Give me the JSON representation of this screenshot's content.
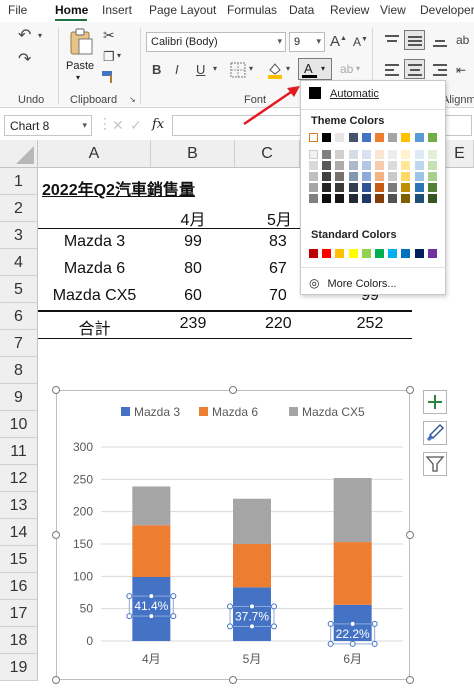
{
  "ribbon": {
    "tabs": [
      "File",
      "Home",
      "Insert",
      "Page Layout",
      "Formulas",
      "Data",
      "Review",
      "View",
      "Developer"
    ],
    "active_tab": "Home",
    "groups": {
      "undo": "Undo",
      "clipboard": "Clipboard",
      "font": "Font",
      "alignment": "Alignm"
    },
    "paste_label": "Paste",
    "font_name": "Calibri (Body)",
    "font_size": "9",
    "font_color_letter": "A",
    "bold": "B",
    "italic": "I",
    "underline": "U",
    "grow_font": "A",
    "shrink_font": "A"
  },
  "formula_bar": {
    "name_box": "Chart 8",
    "fx": "fx"
  },
  "color_menu": {
    "automatic": "Automatic",
    "theme_colors_header": "Theme Colors",
    "standard_colors_header": "Standard Colors",
    "more_colors": "More Colors...",
    "theme_colors": [
      [
        "#ffffff",
        "#f2f2f2",
        "#d9d9d9",
        "#bfbfbf",
        "#a6a6a6",
        "#7f7f7f"
      ],
      [
        "#000000",
        "#7f7f7f",
        "#595959",
        "#404040",
        "#262626",
        "#0d0d0d"
      ],
      [
        "#e7e6e6",
        "#d0cece",
        "#aeaaaa",
        "#757171",
        "#3b3838",
        "#171616"
      ],
      [
        "#44546a",
        "#d6dce4",
        "#adb9ca",
        "#8497b0",
        "#333f4f",
        "#222a35"
      ],
      [
        "#4472c4",
        "#d9e2f3",
        "#b4c6e7",
        "#8eaadb",
        "#2f5496",
        "#1f3864"
      ],
      [
        "#ed7d31",
        "#fbe5d5",
        "#f8cbad",
        "#f4b183",
        "#c55a11",
        "#843c0b"
      ],
      [
        "#a5a5a5",
        "#ededed",
        "#dbdbdb",
        "#c9c9c9",
        "#7b7b7b",
        "#525252"
      ],
      [
        "#ffc000",
        "#fff2cc",
        "#ffe699",
        "#ffd966",
        "#bf8f00",
        "#7f6000"
      ],
      [
        "#5b9bd5",
        "#deebf6",
        "#bdd7ee",
        "#9dc3e6",
        "#2e75b5",
        "#1f4e79"
      ],
      [
        "#70ad47",
        "#e2efd9",
        "#c5e0b3",
        "#a8d08d",
        "#538135",
        "#375623"
      ]
    ],
    "standard_colors": [
      "#c00000",
      "#ff0000",
      "#ffc000",
      "#ffff00",
      "#92d050",
      "#00b050",
      "#00b0f0",
      "#0070c0",
      "#002060",
      "#7030a0"
    ]
  },
  "sheet": {
    "columns": [
      "A",
      "B",
      "C",
      "E"
    ],
    "rows": [
      "1",
      "2",
      "3",
      "4",
      "5",
      "6",
      "7",
      "8",
      "9",
      "10",
      "11",
      "12",
      "13",
      "14",
      "15",
      "16",
      "17",
      "18",
      "19"
    ],
    "title": "2022年Q2汽車銷售量",
    "header_row": [
      "4月",
      "5月"
    ],
    "data_rows": [
      {
        "label": "Mazda 3",
        "v1": "99",
        "v2": "83"
      },
      {
        "label": "Mazda 6",
        "v1": "80",
        "v2": "67"
      },
      {
        "label": "Mazda CX5",
        "v1": "60",
        "v2": "70",
        "v3": "99"
      },
      {
        "label": "合計",
        "v1": "239",
        "v2": "220",
        "v3": "252"
      }
    ]
  },
  "chart_data": {
    "type": "bar",
    "stacked": true,
    "categories": [
      "4月",
      "5月",
      "6月"
    ],
    "series": [
      {
        "name": "Mazda 3",
        "color": "#4472c4",
        "values": [
          99,
          83,
          56
        ]
      },
      {
        "name": "Mazda 6",
        "color": "#ed7d31",
        "values": [
          80,
          67,
          97
        ]
      },
      {
        "name": "Mazda CX5",
        "color": "#a5a5a5",
        "values": [
          60,
          70,
          99
        ]
      }
    ],
    "data_labels": [
      "41.4%",
      "37.7%",
      "22.2%"
    ],
    "ylim": [
      0,
      300
    ],
    "yticks": [
      "0",
      "50",
      "100",
      "150",
      "200",
      "250",
      "300"
    ],
    "grid": true,
    "legend_position": "top"
  }
}
